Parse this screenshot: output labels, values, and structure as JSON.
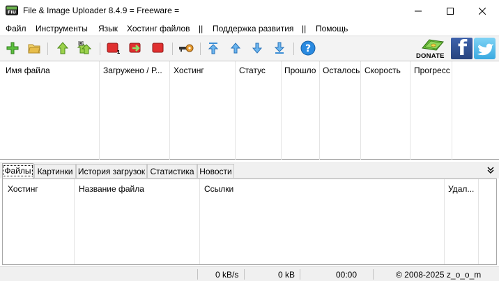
{
  "window": {
    "title": "File & Image Uploader 8.4.9  = Freeware =",
    "icon": "fiu-app-icon",
    "controls": [
      "minimize",
      "maximize",
      "close"
    ]
  },
  "menu": {
    "file": "Файл",
    "tools": "Инструменты",
    "language": "Язык",
    "hosting": "Хостинг файлов",
    "sep1": "||",
    "support": "Поддержка развития",
    "sep2": "||",
    "help": "Помощь"
  },
  "toolbar": {
    "buttons": [
      {
        "name": "add-files",
        "icon": "plus-icon",
        "color": "#4caf3a"
      },
      {
        "name": "open-folder",
        "icon": "folder-icon",
        "color": "#e8c45a"
      },
      {
        "name": "upload",
        "icon": "arrow-up-icon",
        "color": "#8cc63f"
      },
      {
        "name": "upload-resume",
        "icon": "arrow-up-double-icon",
        "color": "#8cc63f"
      },
      {
        "name": "stop-one",
        "icon": "stop-icon",
        "color": "#d62c2c"
      },
      {
        "name": "retry",
        "icon": "redo-icon",
        "color": "#d62c2c"
      },
      {
        "name": "stop-all",
        "icon": "stop-icon",
        "color": "#d62c2c"
      },
      {
        "name": "keys",
        "icon": "key-icon",
        "color": "#b86a1e"
      },
      {
        "name": "move-top",
        "icon": "move-top-icon",
        "color": "#4fa3e0"
      },
      {
        "name": "move-up",
        "icon": "move-up-icon",
        "color": "#4fa3e0"
      },
      {
        "name": "move-down",
        "icon": "move-down-icon",
        "color": "#4fa3e0"
      },
      {
        "name": "move-bottom",
        "icon": "move-bottom-icon",
        "color": "#4fa3e0"
      },
      {
        "name": "help",
        "icon": "help-icon",
        "color": "#1e7fd8"
      }
    ],
    "donate_label": "DONATE",
    "facebook_letter": "f",
    "twitter_icon": "twitter-bird-icon"
  },
  "upload_list": {
    "columns": [
      "Имя файла",
      "Загружено / Р...",
      "Хостинг",
      "Статус",
      "Прошло",
      "Осталось",
      "Скорость",
      "Прогресс"
    ],
    "rows": []
  },
  "tabs": [
    {
      "label": "Файлы",
      "active": true
    },
    {
      "label": "Картинки",
      "active": false
    },
    {
      "label": "История загрузок",
      "active": false
    },
    {
      "label": "Статистика",
      "active": false
    },
    {
      "label": "Новости",
      "active": false
    }
  ],
  "files_table": {
    "columns": [
      "Хостинг",
      "Название файла",
      "Ссылки",
      "Удал..."
    ],
    "rows": []
  },
  "status": {
    "speed": "0 kB/s",
    "size": "0 kB",
    "time": "00:00",
    "copyright": "© 2008-2025 z_o_o_m"
  }
}
